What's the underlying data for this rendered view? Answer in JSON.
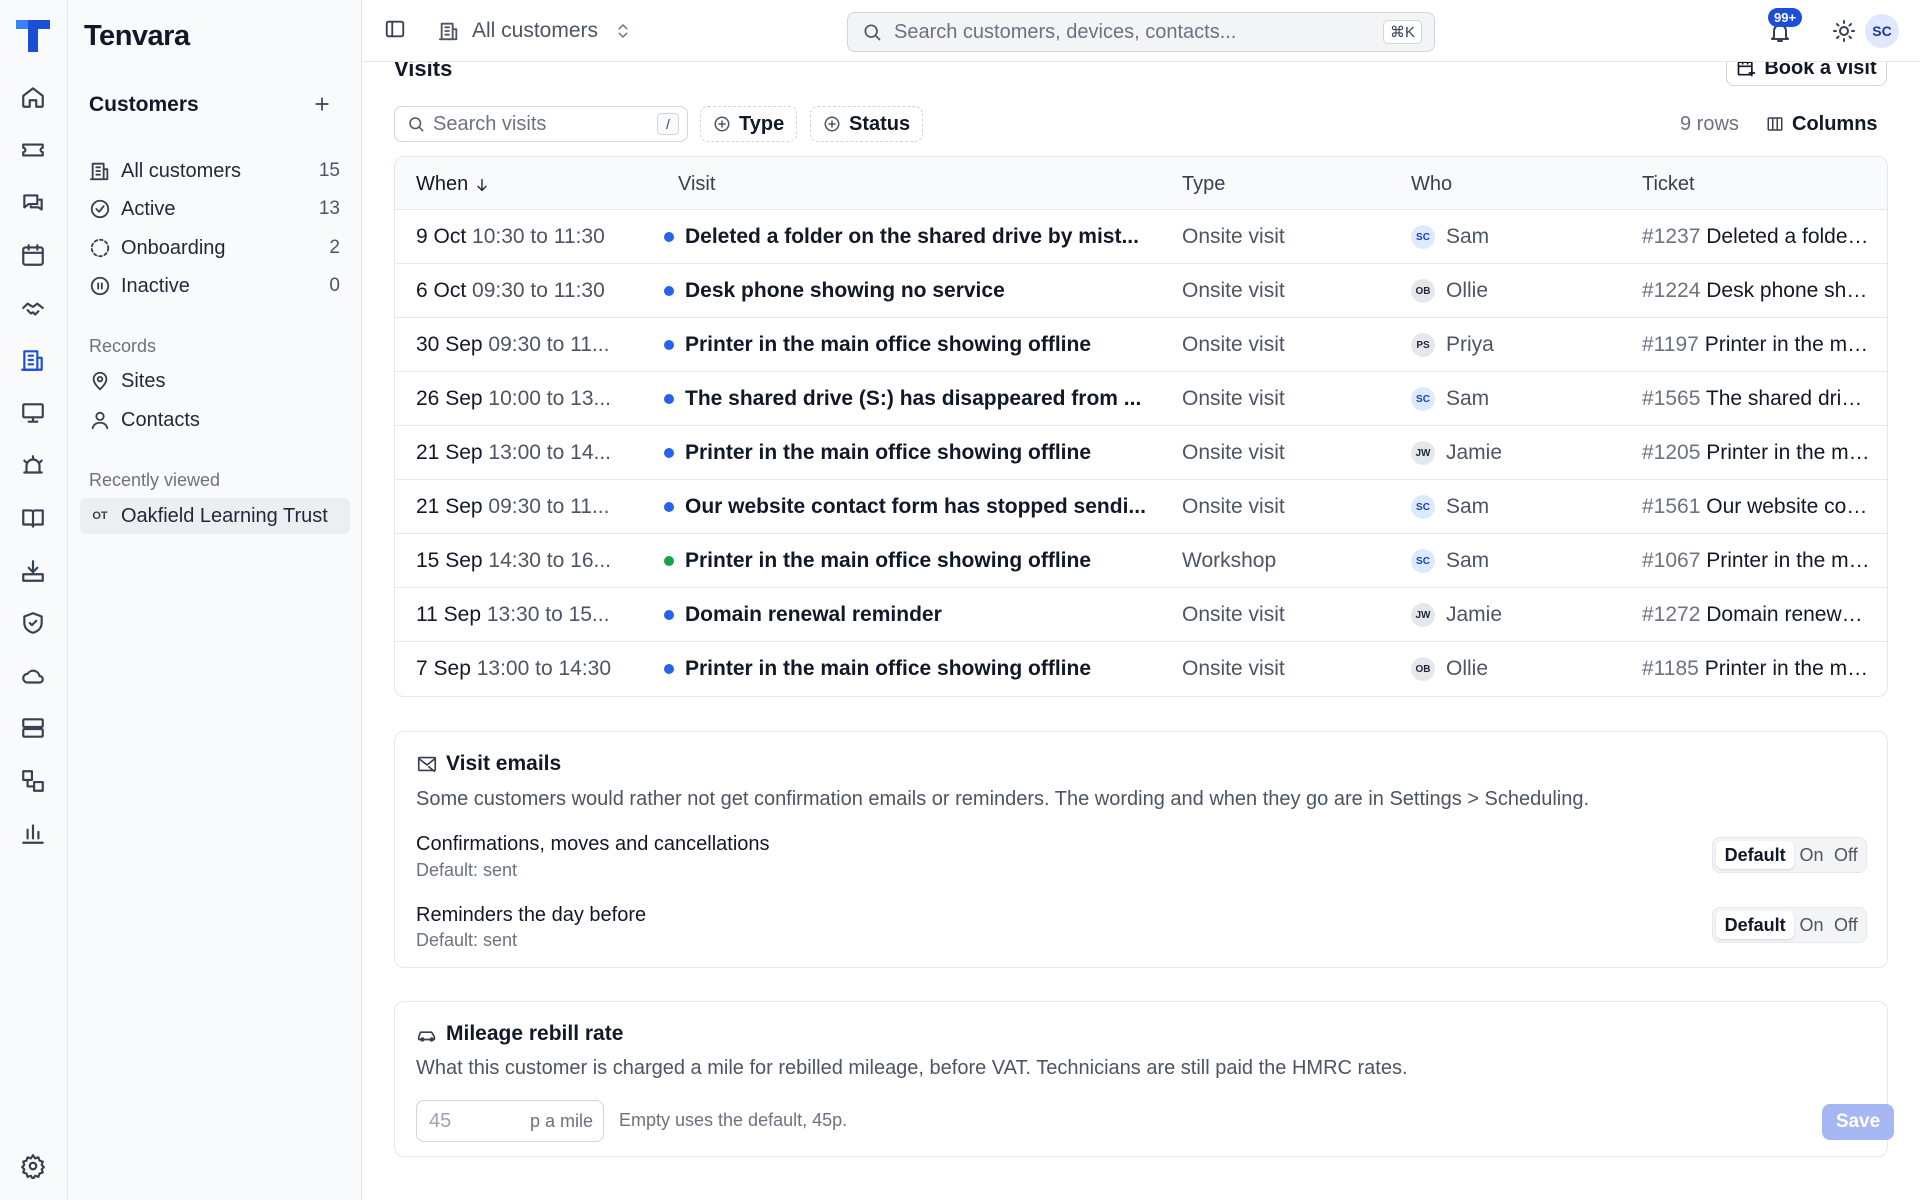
{
  "app": {
    "name": "Tenvara"
  },
  "topbar": {
    "scope_label": "All customers",
    "search_placeholder": "Search customers, devices, contacts...",
    "search_shortcut": "⌘K",
    "notification_count": "99+",
    "user_initials": "SC"
  },
  "sidebar": {
    "heading": "Customers",
    "items": [
      {
        "label": "All customers",
        "count": "15",
        "icon": "building-icon"
      },
      {
        "label": "Active",
        "count": "13",
        "icon": "check-circle-icon"
      },
      {
        "label": "Onboarding",
        "count": "2",
        "icon": "dashed-circle-icon"
      },
      {
        "label": "Inactive",
        "count": "0",
        "icon": "pause-circle-icon"
      }
    ],
    "records_heading": "Records",
    "records": [
      {
        "label": "Sites",
        "icon": "map-pin-icon"
      },
      {
        "label": "Contacts",
        "icon": "user-icon"
      }
    ],
    "recent_heading": "Recently viewed",
    "recent": [
      {
        "initials": "OT",
        "label": "Oakfield Learning Trust"
      }
    ]
  },
  "visits": {
    "title": "Visits",
    "book_label": "Book a visit",
    "search_placeholder": "Search visits",
    "search_shortcut": "/",
    "filter_type": "Type",
    "filter_status": "Status",
    "rows_label": "9 rows",
    "columns_label": "Columns",
    "headers": {
      "when": "When",
      "visit": "Visit",
      "type": "Type",
      "who": "Who",
      "ticket": "Ticket"
    },
    "rows": [
      {
        "date": "9 Oct",
        "time": "10:30 to 11:30",
        "dot_color": "#2563eb",
        "visit": "Deleted a folder on the shared drive by mist...",
        "type": "Onsite visit",
        "who_initials": "SC",
        "who": "Sam",
        "who_style": "blue",
        "ticket_no": "#1237",
        "ticket_title": "Deleted a folder ..."
      },
      {
        "date": "6 Oct",
        "time": "09:30 to 11:30",
        "dot_color": "#2563eb",
        "visit": "Desk phone showing no service",
        "type": "Onsite visit",
        "who_initials": "OB",
        "who": "Ollie",
        "who_style": "grey",
        "ticket_no": "#1224",
        "ticket_title": "Desk phone sho..."
      },
      {
        "date": "30 Sep",
        "time": "09:30 to 11...",
        "dot_color": "#2563eb",
        "visit": "Printer in the main office showing offline",
        "type": "Onsite visit",
        "who_initials": "PS",
        "who": "Priya",
        "who_style": "grey",
        "ticket_no": "#1197",
        "ticket_title": "Printer in the mai..."
      },
      {
        "date": "26 Sep",
        "time": "10:00 to 13...",
        "dot_color": "#2563eb",
        "visit": "The shared drive (S:) has disappeared from ...",
        "type": "Onsite visit",
        "who_initials": "SC",
        "who": "Sam",
        "who_style": "blue",
        "ticket_no": "#1565",
        "ticket_title": "The shared drive..."
      },
      {
        "date": "21 Sep",
        "time": "13:00 to 14...",
        "dot_color": "#2563eb",
        "visit": "Printer in the main office showing offline",
        "type": "Onsite visit",
        "who_initials": "JW",
        "who": "Jamie",
        "who_style": "grey",
        "ticket_no": "#1205",
        "ticket_title": "Printer in the mai..."
      },
      {
        "date": "21 Sep",
        "time": "09:30 to 11...",
        "dot_color": "#2563eb",
        "visit": "Our website contact form has stopped sendi...",
        "type": "Onsite visit",
        "who_initials": "SC",
        "who": "Sam",
        "who_style": "blue",
        "ticket_no": "#1561",
        "ticket_title": "Our website cont..."
      },
      {
        "date": "15 Sep",
        "time": "14:30 to 16...",
        "dot_color": "#16a34a",
        "visit": "Printer in the main office showing offline",
        "type": "Workshop",
        "who_initials": "SC",
        "who": "Sam",
        "who_style": "blue",
        "ticket_no": "#1067",
        "ticket_title": "Printer in the mai..."
      },
      {
        "date": "11 Sep",
        "time": "13:30 to 15...",
        "dot_color": "#2563eb",
        "visit": "Domain renewal reminder",
        "type": "Onsite visit",
        "who_initials": "JW",
        "who": "Jamie",
        "who_style": "grey",
        "ticket_no": "#1272",
        "ticket_title": "Domain renewal ..."
      },
      {
        "date": "7 Sep",
        "time": "13:00 to 14:30",
        "dot_color": "#2563eb",
        "visit": "Printer in the main office showing offline",
        "type": "Onsite visit",
        "who_initials": "OB",
        "who": "Ollie",
        "who_style": "grey",
        "ticket_no": "#1185",
        "ticket_title": "Printer in the mai..."
      }
    ]
  },
  "emails": {
    "title": "Visit emails",
    "description": "Some customers would rather not get confirmation emails or reminders. The wording and when they go are in Settings > Scheduling.",
    "options": [
      {
        "label": "Confirmations, moves and cancellations",
        "sub": "Default: sent",
        "choices": [
          "Default",
          "On",
          "Off"
        ],
        "selected": "Default"
      },
      {
        "label": "Reminders the day before",
        "sub": "Default: sent",
        "choices": [
          "Default",
          "On",
          "Off"
        ],
        "selected": "Default"
      }
    ]
  },
  "mileage": {
    "title": "Mileage rebill rate",
    "description": "What this customer is charged a mile for rebilled mileage, before VAT. Technicians are still paid the HMRC rates.",
    "placeholder": "45",
    "unit": "p a mile",
    "hint": "Empty uses the default, 45p.",
    "save_label": "Save"
  },
  "colors": {
    "accent": "#1d4ed8",
    "save_disabled": "#a5b8f3"
  }
}
